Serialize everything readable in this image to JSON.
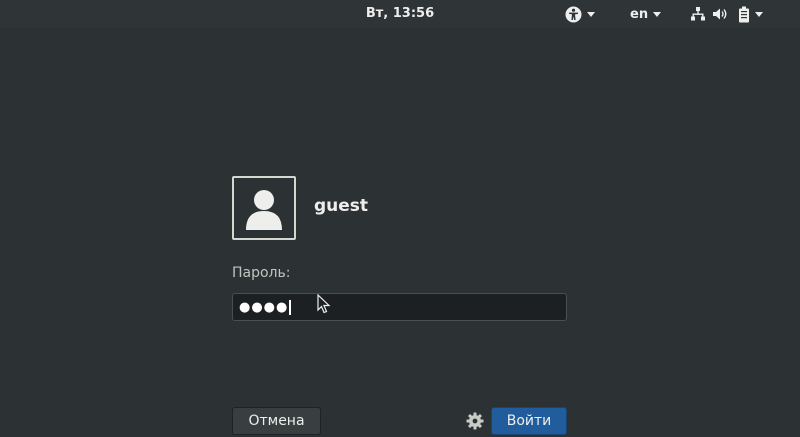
{
  "topbar": {
    "clock": "Вт, 13:56",
    "accessibility_icon": "accessibility-icon",
    "language": "en",
    "network_icon": "network-wired-icon",
    "volume_icon": "speaker-volume-icon",
    "battery_icon": "battery-icon"
  },
  "login": {
    "username": "guest",
    "avatar_icon": "user-avatar-icon",
    "password_label": "Пароль:",
    "password_mask": "●●●●",
    "cancel_label": "Отмена",
    "login_label": "Войти",
    "settings_icon": "gear-icon"
  },
  "colors": {
    "background": "#2c3133",
    "accent": "#215d9c",
    "text": "#eeeeec"
  }
}
